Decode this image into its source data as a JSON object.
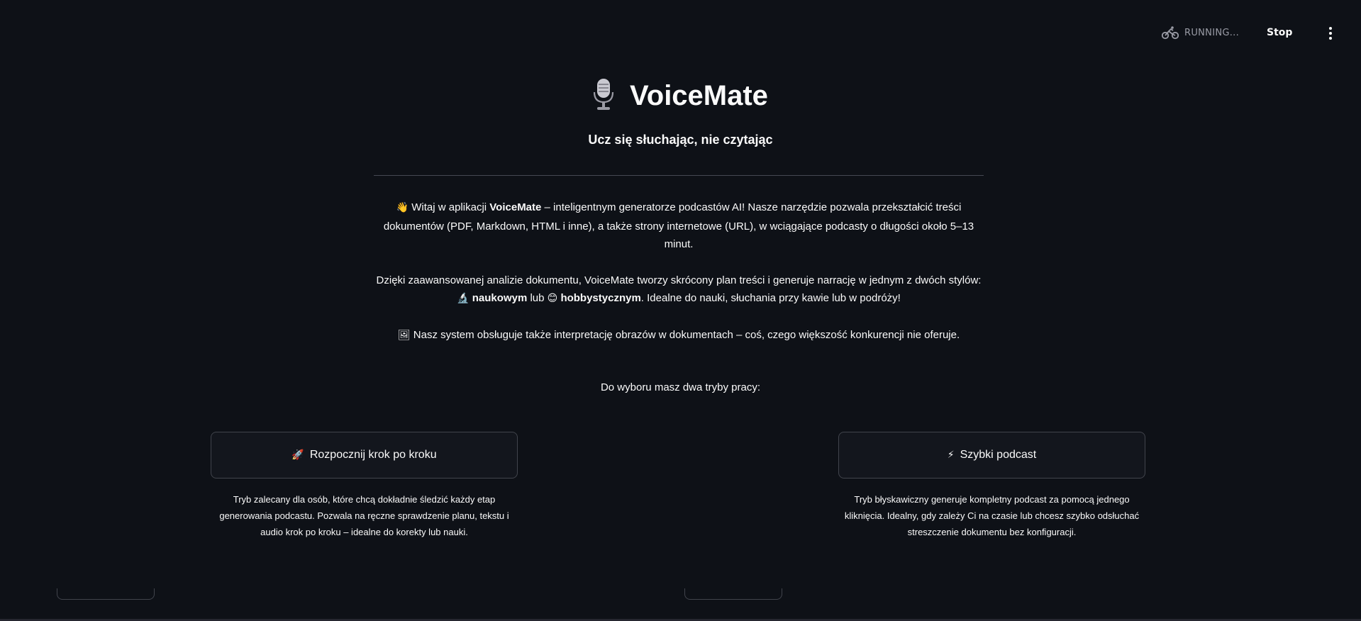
{
  "header": {
    "status_text": "RUNNING...",
    "stop_label": "Stop",
    "status_icon": "cyclist-icon",
    "menu_icon": "kebab-menu-icon"
  },
  "title": {
    "icon": "microphone-icon",
    "text": "VoiceMate",
    "subtitle": "Ucz się słuchając, nie czytając"
  },
  "intro": {
    "p1_icon": "👋",
    "p1_before": " Witaj w aplikacji ",
    "p1_brand": "VoiceMate",
    "p1_after": " – inteligentnym generatorze podcastów AI! Nasze narzędzie pozwala przekształcić treści dokumentów (PDF, Markdown, HTML i inne), a także strony internetowe (URL), w wciągające podcasty o długości około 5–13 minut.",
    "p2_before": "Dzięki zaawansowanej analizie dokumentu, VoiceMate tworzy skrócony plan treści i generuje narrację w jednym z dwóch stylów: ",
    "p2_icon1": "🔬",
    "p2_style1": "naukowym",
    "p2_mid": " lub ",
    "p2_icon2": "😊",
    "p2_style2": "hobbystycznym",
    "p2_after": ". Idealne do nauki, słuchania przy kawie lub w podróży!",
    "p3_icon": "🖼",
    "p3_text": " Nasz system obsługuje także interpretację obrazów w dokumentach – coś, czego większość konkurencji nie oferuje."
  },
  "modes": {
    "heading": "Do wyboru masz dwa tryby pracy:",
    "step_by_step": {
      "icon": "🚀",
      "label": "Rozpocznij krok po kroku",
      "description": "Tryb zalecany dla osób, które chcą dokładnie śledzić każdy etap generowania podcastu. Pozwala na ręczne sprawdzenie planu, tekstu i audio krok po kroku – idealne do korekty lub nauki."
    },
    "quick": {
      "icon": "⚡",
      "label": "Szybki podcast",
      "description": "Tryb błyskawiczny generuje kompletny podcast za pomocą jednego kliknięcia. Idealny, gdy zależy Ci na czasie lub chcesz szybko odsłuchać streszczenie dokumentu bez konfiguracji."
    }
  },
  "colors": {
    "background": "#0e1117",
    "text": "#fafafa",
    "border": "#41444c",
    "muted": "#9a9ca6",
    "rocket": "#e0603a",
    "bolt": "#f0a030"
  }
}
